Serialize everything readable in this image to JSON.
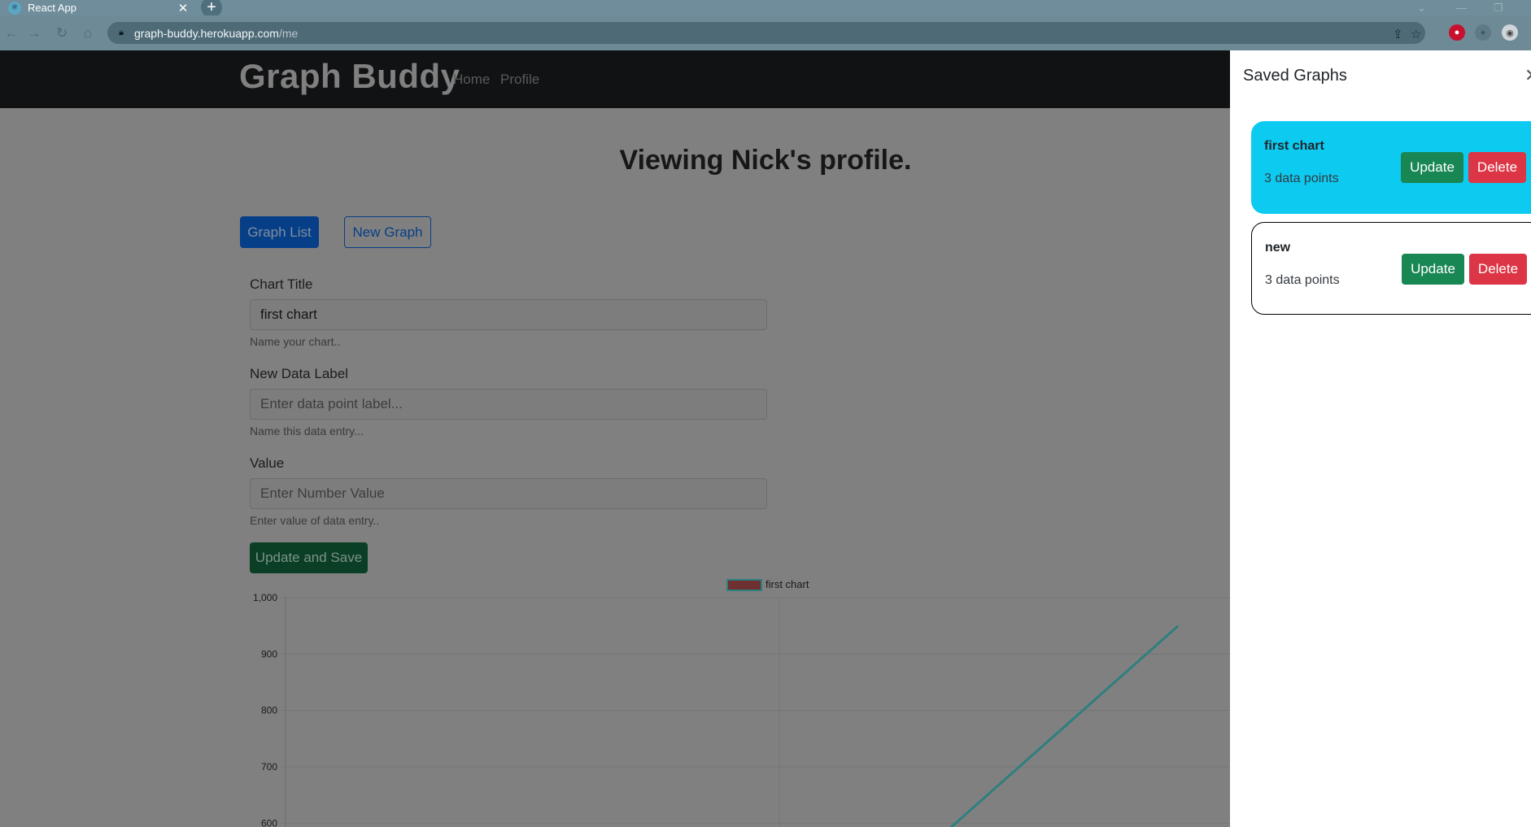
{
  "browser": {
    "tab_title": "React App",
    "tab_close": "✕",
    "new_tab": "+",
    "url_host": "graph-buddy.herokuapp.com",
    "url_path": "/me"
  },
  "app": {
    "brand": "Graph Buddy",
    "nav": {
      "home": "Home",
      "profile": "Profile"
    },
    "heading": "Viewing Nick's profile.",
    "buttons": {
      "graph_list": "Graph List",
      "new_graph": "New Graph",
      "save": "Update and Save"
    },
    "form": {
      "chart_title_label": "Chart Title",
      "chart_title_value": "first chart",
      "chart_title_help": "Name your chart..",
      "data_label_label": "New Data Label",
      "data_label_placeholder": "Enter data point label...",
      "data_label_help": "Name this data entry...",
      "value_label": "Value",
      "value_placeholder": "Enter Number Value",
      "value_help": "Enter value of data entry.."
    }
  },
  "chart_data": {
    "type": "line",
    "title": "",
    "legend": [
      "first chart"
    ],
    "legend_position": "top",
    "series": [
      {
        "name": "first chart",
        "color": "#2e7f7f",
        "points": [
          [
            1.23,
            550
          ],
          [
            1.72,
            950
          ]
        ]
      }
    ],
    "y_ticks": [
      "1,000",
      "900",
      "800",
      "700",
      "600"
    ],
    "ylim": [
      550,
      1000
    ],
    "xlim": [
      0,
      1.82
    ],
    "grid": true
  },
  "panel": {
    "title": "Saved Graphs",
    "close": "✕",
    "graphs": [
      {
        "name": "first chart",
        "points": "3 data points",
        "update": "Update",
        "delete": "Delete"
      },
      {
        "name": "new",
        "points": "3 data points",
        "update": "Update",
        "delete": "Delete"
      }
    ]
  }
}
